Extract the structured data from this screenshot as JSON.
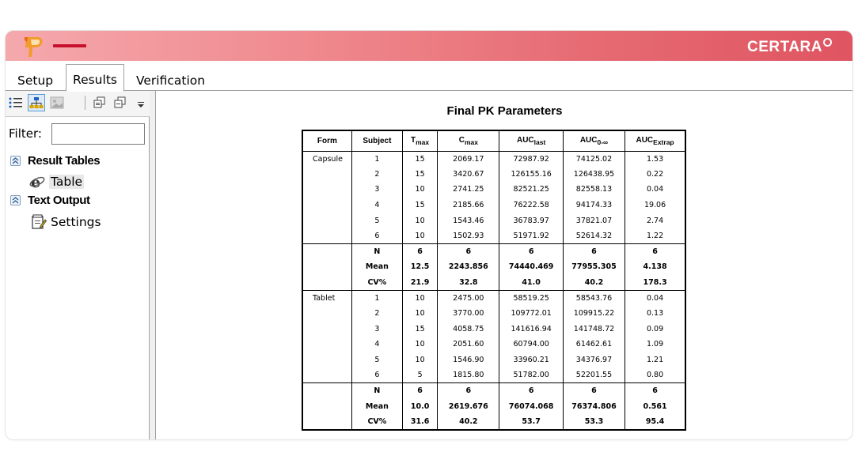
{
  "titlebar": {
    "brand": "CERTARA"
  },
  "tabs": [
    {
      "label": "Setup"
    },
    {
      "label": "Results"
    },
    {
      "label": "Verification"
    }
  ],
  "icons": {
    "list_view": "list-view-icon",
    "tree_view": "tree-view-icon",
    "image": "image-icon",
    "copy": "copy-icon",
    "copy_all": "copy-all-icon",
    "dropdown": "toolbar-dropdown-icon"
  },
  "colors": {
    "titlebar_start": "#f5a9ad",
    "titlebar_end": "#df5561",
    "accent": "#c8102e"
  },
  "filter": {
    "label": "Filter:",
    "value": ""
  },
  "tree": {
    "groups": [
      {
        "label": "Result Tables",
        "items": [
          {
            "label": "Table",
            "icon": "ie-icon"
          }
        ]
      },
      {
        "label": "Text Output",
        "items": [
          {
            "label": "Settings",
            "icon": "settings-doc-icon"
          }
        ]
      }
    ]
  },
  "table": {
    "title": "Final PK Parameters",
    "headers": [
      {
        "main": "Form",
        "sub": ""
      },
      {
        "main": "Subject",
        "sub": ""
      },
      {
        "main": "T",
        "sub": "max"
      },
      {
        "main": "C",
        "sub": "max"
      },
      {
        "main": "AUC",
        "sub": "last"
      },
      {
        "main": "AUC",
        "sub": "0-∞"
      },
      {
        "main": "AUC",
        "sub": "Extrap"
      }
    ],
    "groups": [
      {
        "form": "Capsule",
        "rows": [
          [
            "1",
            "15",
            "2069.17",
            "72987.92",
            "74125.02",
            "1.53"
          ],
          [
            "2",
            "15",
            "3420.67",
            "126155.16",
            "126438.95",
            "0.22"
          ],
          [
            "3",
            "10",
            "2741.25",
            "82521.25",
            "82558.13",
            "0.04"
          ],
          [
            "4",
            "15",
            "2185.66",
            "76222.58",
            "94174.33",
            "19.06"
          ],
          [
            "5",
            "10",
            "1543.46",
            "36783.97",
            "37821.07",
            "2.74"
          ],
          [
            "6",
            "10",
            "1502.93",
            "51971.92",
            "52614.32",
            "1.22"
          ]
        ],
        "stats": [
          [
            "N",
            "6",
            "6",
            "6",
            "6",
            "6"
          ],
          [
            "Mean",
            "12.5",
            "2243.856",
            "74440.469",
            "77955.305",
            "4.138"
          ],
          [
            "CV%",
            "21.9",
            "32.8",
            "41.0",
            "40.2",
            "178.3"
          ]
        ]
      },
      {
        "form": "Tablet",
        "rows": [
          [
            "1",
            "10",
            "2475.00",
            "58519.25",
            "58543.76",
            "0.04"
          ],
          [
            "2",
            "10",
            "3770.00",
            "109772.01",
            "109915.22",
            "0.13"
          ],
          [
            "3",
            "15",
            "4058.75",
            "141616.94",
            "141748.72",
            "0.09"
          ],
          [
            "4",
            "10",
            "2051.60",
            "60794.00",
            "61462.61",
            "1.09"
          ],
          [
            "5",
            "10",
            "1546.90",
            "33960.21",
            "34376.97",
            "1.21"
          ],
          [
            "6",
            "5",
            "1815.80",
            "51782.00",
            "52201.55",
            "0.80"
          ]
        ],
        "stats": [
          [
            "N",
            "6",
            "6",
            "6",
            "6",
            "6"
          ],
          [
            "Mean",
            "10.0",
            "2619.676",
            "76074.068",
            "76374.806",
            "0.561"
          ],
          [
            "CV%",
            "31.6",
            "40.2",
            "53.7",
            "53.3",
            "95.4"
          ]
        ]
      }
    ]
  }
}
